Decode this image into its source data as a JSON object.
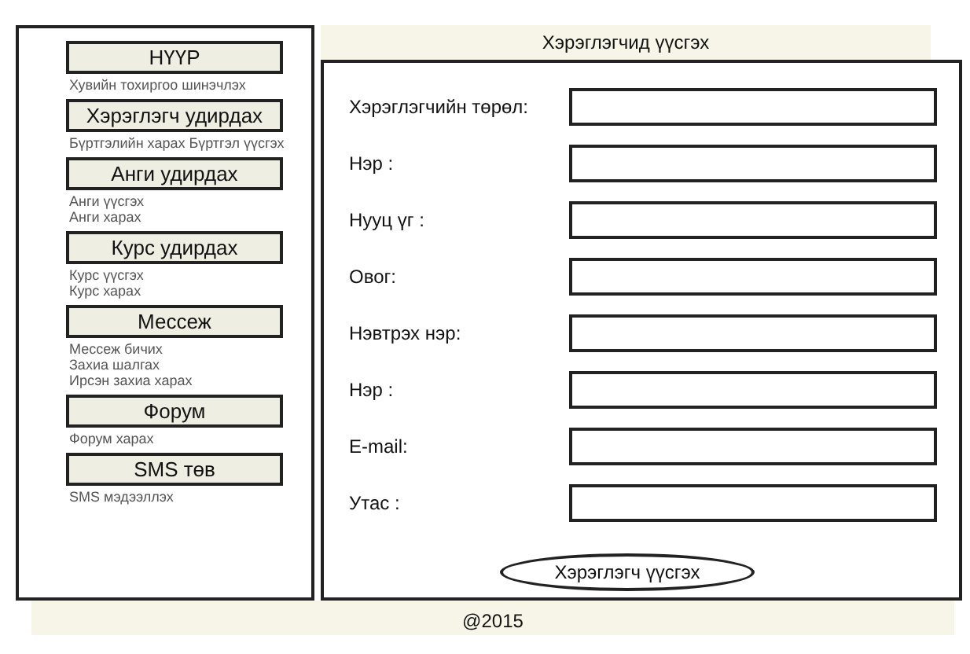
{
  "sidebar": {
    "sections": [
      {
        "button": "НҮҮР",
        "links": [
          "Хувийн тохиргоо шинэчлэх"
        ]
      },
      {
        "button": "Хэрэглэгч удирдах",
        "links": [
          "Бүртгэлийн харах Бүртгэл үүсгэх"
        ]
      },
      {
        "button": "Анги удирдах",
        "links": [
          "Анги үүсгэх",
          "Анги харах"
        ]
      },
      {
        "button": "Курс удирдах",
        "links": [
          "Курс үүсгэх",
          "Курс харах"
        ]
      },
      {
        "button": "Мессеж",
        "links": [
          "Мессеж бичих",
          "Захиа шалгах",
          "Ирсэн захиа харах"
        ]
      },
      {
        "button": "Форум",
        "links": [
          "Форум харах"
        ]
      },
      {
        "button": "SMS төв",
        "links": [
          "SMS мэдээллэх"
        ]
      }
    ]
  },
  "form": {
    "title": "Хэрэглэгчид үүсгэх",
    "fields": [
      {
        "label": "Хэрэглэгчийн төрөл:"
      },
      {
        "label": "Нэр :"
      },
      {
        "label": "Нууц үг :"
      },
      {
        "label": "Овог:"
      },
      {
        "label": "Нэвтрэх нэр:"
      },
      {
        "label": "Нэр :"
      },
      {
        "label": "E-mail:"
      },
      {
        "label": "Утас :"
      }
    ],
    "submit": "Хэрэглэгч үүсгэх"
  },
  "footer": "@2015"
}
